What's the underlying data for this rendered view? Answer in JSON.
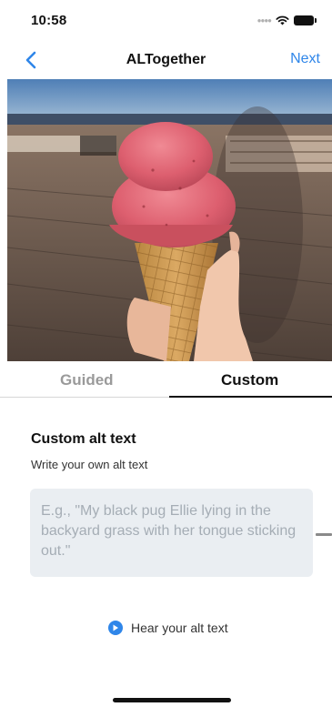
{
  "status_bar": {
    "time": "10:58",
    "icons": [
      "signal-dots-icon",
      "wifi-icon",
      "battery-icon"
    ]
  },
  "nav": {
    "back_icon": "chevron-left-icon",
    "title": "ALTogether",
    "next_label": "Next"
  },
  "photo": {
    "subject": "hand-holding-strawberry-ice-cream-cone"
  },
  "tabs": [
    {
      "label": "Guided",
      "selected": false
    },
    {
      "label": "Custom",
      "selected": true
    }
  ],
  "custom": {
    "title": "Custom alt text",
    "subtitle": "Write your own alt text",
    "input_value": "",
    "input_placeholder": "E.g., \"My black pug Ellie lying in the backyard grass with her tongue sticking out.\""
  },
  "hear": {
    "icon": "play-circle-icon",
    "label": "Hear your alt text"
  },
  "colors": {
    "accent": "#2f86e9",
    "input_background": "#eaeef2",
    "tab_inactive": "#9a9a9a"
  }
}
